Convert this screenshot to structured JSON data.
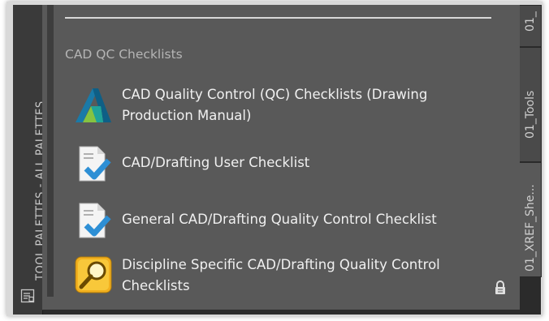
{
  "palette": {
    "title": "TOOL PALETTES - ALL PALETTES",
    "section_label": "CAD QC Checklists",
    "tools": [
      {
        "label": "CAD Quality Control (QC) Checklists (Drawing Production Manual)",
        "icon": "autodesk-logo-icon"
      },
      {
        "label": "CAD/Drafting User Checklist",
        "icon": "document-checkmark-icon"
      },
      {
        "label": "General CAD/Drafting Quality Control Checklist",
        "icon": "document-checkmark-icon"
      },
      {
        "label": "Discipline Specific CAD/Drafting Quality Control Checklists",
        "icon": "magnifier-search-icon"
      }
    ]
  },
  "tabs": [
    {
      "label": "01_"
    },
    {
      "label": "01_Tools"
    },
    {
      "label": "01_XREF_She..."
    }
  ],
  "colors": {
    "panel_background": "#595959",
    "strip_background": "#3a3a3a",
    "text": "#f0f0f0",
    "section_text": "#b5b5b5"
  }
}
